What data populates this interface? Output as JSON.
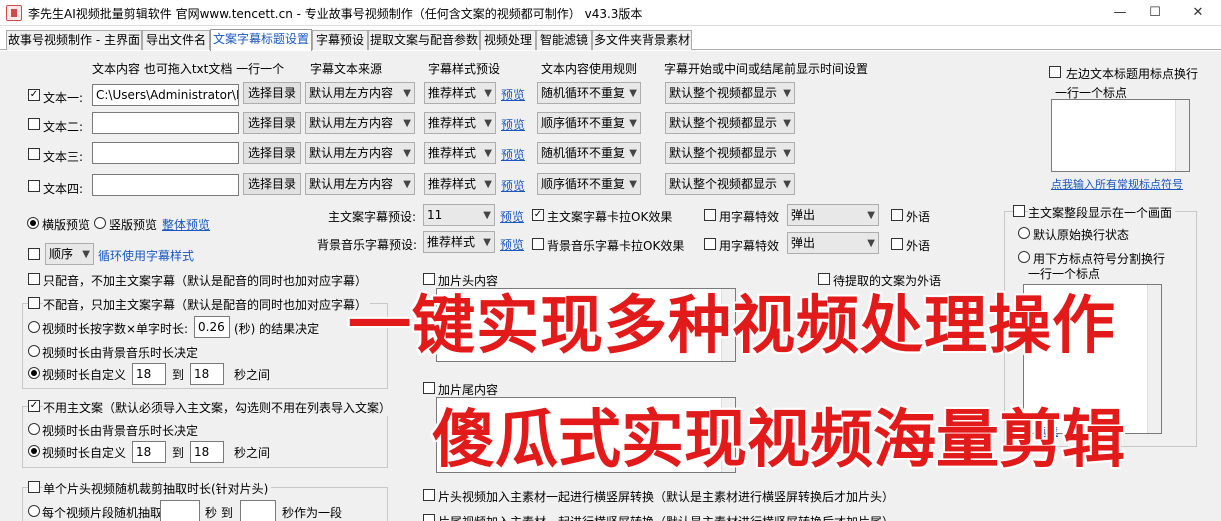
{
  "window": {
    "title": "李先生AI视频批量剪辑软件    官网www.tencett.cn -  专业故事号视频制作（任何含文案的视频都可制作）   v43.3版本",
    "min": "—",
    "max": "☐",
    "close": "✕"
  },
  "tabs": [
    "故事号视频制作 - 主界面",
    "导出文件名",
    "文案字幕标题设置",
    "字幕预设",
    "提取文案与配音参数",
    "视频处理",
    "智能滤镜",
    "多文件夹背景素材"
  ],
  "headers": {
    "content": "文本内容 也可拖入txt文档 一行一个",
    "source": "字幕文本来源",
    "style": "字幕样式预设",
    "rule": "文本内容使用规则",
    "time": "字幕开始或中间或结尾前显示时间设置"
  },
  "rows": [
    {
      "label": "文本一:",
      "checked": "✓",
      "path": "C:\\Users\\Administrator\\De",
      "btn": "选择目录",
      "source": "默认用左方内容",
      "style": "推荐样式",
      "preview": "预览",
      "rule": "随机循环不重复",
      "time": "默认整个视频都显示"
    },
    {
      "label": "文本二:",
      "checked": "",
      "path": "",
      "btn": "选择目录",
      "source": "默认用左方内容",
      "style": "推荐样式",
      "preview": "预览",
      "rule": "顺序循环不重复",
      "time": "默认整个视频都显示"
    },
    {
      "label": "文本三:",
      "checked": "",
      "path": "",
      "btn": "选择目录",
      "source": "默认用左方内容",
      "style": "推荐样式",
      "preview": "预览",
      "rule": "随机循环不重复",
      "time": "默认整个视频都显示"
    },
    {
      "label": "文本四:",
      "checked": "",
      "path": "",
      "btn": "选择目录",
      "source": "默认用左方内容",
      "style": "推荐样式",
      "preview": "预览",
      "rule": "顺序循环不重复",
      "time": "默认整个视频都显示"
    }
  ],
  "right_top": {
    "check": "左边文本标题用标点换行",
    "line": "一行一个标点",
    "link": "点我输入所有常规标点符号"
  },
  "preview": {
    "horizontal": "横版预览",
    "vertical": "竖版预览",
    "whole": "整体预览"
  },
  "order": {
    "value": "顺序",
    "link": "循环使用字幕样式"
  },
  "main_sub": {
    "label": "主文案字幕预设:",
    "value": "11",
    "preview": "预览",
    "karaoke": "主文案字幕卡拉OK效果",
    "effect": "用字幕特效",
    "effect_value": "弹出",
    "outer": "外语"
  },
  "bgm_sub": {
    "label": "背景音乐字幕预设:",
    "value": "推荐样式",
    "preview": "预览",
    "karaoke": "背景音乐字幕卡拉OK效果",
    "effect": "用字幕特效",
    "effect_value": "弹出",
    "outer": "外语"
  },
  "left_opts": {
    "dub_only": "只配音，不加主文案字幕（默认是配音的同时也加对应字幕）",
    "no_dub": "不配音，只加主文案字幕（默认是配音的同时也加对应字幕）",
    "dur_calc": "视频时长按字数×单字时长:",
    "dur_calc_val": "0.26",
    "dur_calc_suffix": "(秒) 的结果决定",
    "dur_bgm": "视频时长由背景音乐时长决定",
    "dur_custom": "视频时长自定义",
    "dur_from": "18",
    "to": "到",
    "dur_to": "18",
    "between": "秒之间",
    "no_main": "不用主文案（默认必须导入主文案，勾选则不用在列表导入文案）",
    "dur_bgm2": "视频时长由背景音乐时长决定",
    "dur_custom2": "视频时长自定义",
    "dur_from2": "18",
    "dur_to2": "18",
    "single_head": "单个片头视频随机裁剪抽取时长(针对片头)",
    "each_clip": "每个视频片段随机抽取",
    "sec_to": "秒 到",
    "as_one": "秒作为一段"
  },
  "middle": {
    "head": "加片头内容",
    "tail": "加片尾内容",
    "extract_outer": "待提取的文案为外语",
    "head_convert": "片头视频加入主素材一起进行横竖屏转换（默认是主素材进行横竖屏转换后才加片头）",
    "tail_convert": "片尾视频加入主素材一起进行横竖屏转换（默认是主素材进行横竖屏转换后才加片尾）"
  },
  "right_mid": {
    "one_screen": "主文案整段显示在一个画面",
    "default_wrap": "默认原始换行状态",
    "punct_wrap": "用下方标点符号分割换行",
    "line": "一行一个标点",
    "link_partial": "点我"
  },
  "banner": {
    "line1": "一键实现多种视频处理操作",
    "line2": "傻瓜式实现视频海量剪辑"
  }
}
